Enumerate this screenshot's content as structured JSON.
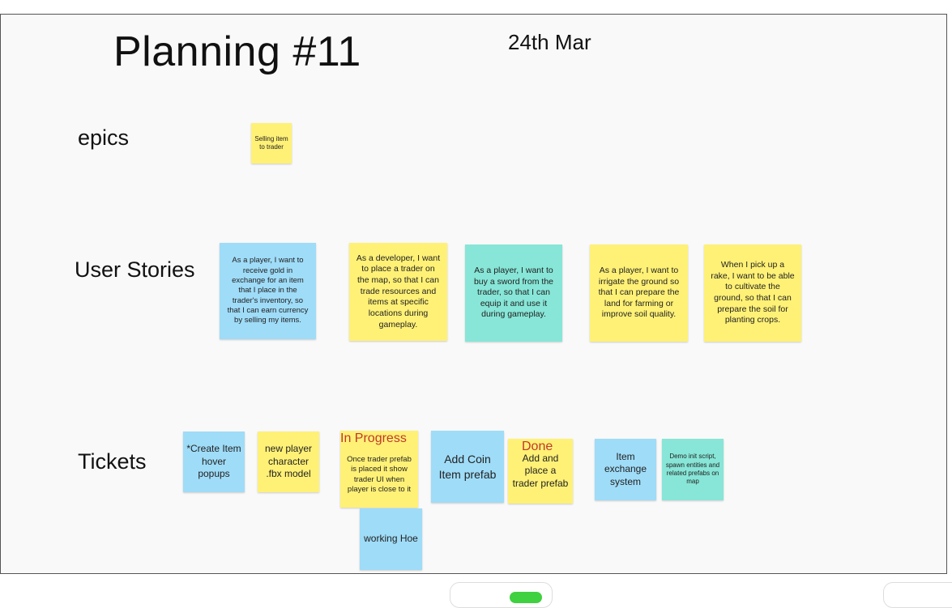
{
  "board": {
    "title": "Planning #11",
    "date": "24th Mar"
  },
  "rows": {
    "epics": "epics",
    "user_stories": "User Stories",
    "tickets": "Tickets"
  },
  "epics": [
    {
      "text": "Selling item to trader",
      "color": "#fff176"
    }
  ],
  "user_stories": [
    {
      "text": "As a player, I want to receive gold in exchange for an item that I place in the trader's inventory, so that I can earn currency by selling my items.",
      "color": "#9fdcf8"
    },
    {
      "text": "As a developer, I want to place a trader on the map, so that I can trade resources and items at specific locations during gameplay.",
      "color": "#fff176"
    },
    {
      "text": "As a player, I want to buy a sword from the trader, so that I can equip it and use it during gameplay.",
      "color": "#87e6d7"
    },
    {
      "text": "As a player, I want to irrigate the ground so that I can prepare the land for farming or improve soil quality.",
      "color": "#fff176"
    },
    {
      "text": "When I pick up a rake, I want to be able to cultivate the ground, so that I can prepare the soil for planting crops.",
      "color": "#fff176"
    }
  ],
  "tickets": [
    {
      "text": "*Create Item hover popups",
      "color": "#9fdcf8"
    },
    {
      "text": "new player character .fbx model",
      "color": "#fff176"
    },
    {
      "text": "Once trader prefab is placed it show trader UI when player is close to it",
      "color": "#fff176"
    },
    {
      "text": "Add Coin Item prefab",
      "color": "#9fdcf8"
    },
    {
      "text": "Add and place a trader prefab",
      "color": "#fff176"
    },
    {
      "text": "Item exchange system",
      "color": "#9fdcf8"
    },
    {
      "text": "Demo init script, spawn entities and related prefabs on map",
      "color": "#87e6d7"
    },
    {
      "text": "working Hoe",
      "color": "#9fdcf8"
    }
  ],
  "status_labels": {
    "in_progress": "In Progress",
    "done": "Done"
  },
  "colors": {
    "status_text": "#c0392b",
    "toggle_green": "#3fd13f"
  }
}
